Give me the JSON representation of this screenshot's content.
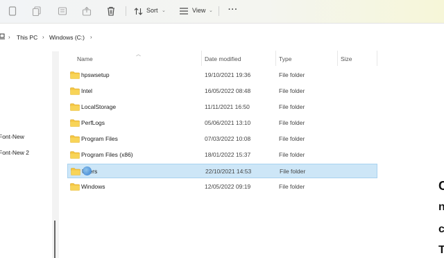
{
  "toolbar": {
    "sort_label": "Sort",
    "view_label": "View",
    "more_label": "···"
  },
  "address": {
    "crumbs": [
      "This PC",
      "Windows (C:)"
    ]
  },
  "sidebar": {
    "items": [
      "Font-New",
      "Font-New 2"
    ]
  },
  "columns": {
    "name": "Name",
    "date": "Date modified",
    "type": "Type",
    "size": "Size"
  },
  "files": [
    {
      "name": "hpswsetup",
      "date": "19/10/2021 19:36",
      "type": "File folder"
    },
    {
      "name": "Intel",
      "date": "16/05/2022 08:48",
      "type": "File folder"
    },
    {
      "name": "LocalStorage",
      "date": "11/11/2021 16:50",
      "type": "File folder"
    },
    {
      "name": "PerfLogs",
      "date": "05/06/2021 13:10",
      "type": "File folder"
    },
    {
      "name": "Program Files",
      "date": "07/03/2022 10:08",
      "type": "File folder"
    },
    {
      "name": "Program Files (x86)",
      "date": "18/01/2022 15:37",
      "type": "File folder"
    },
    {
      "name": "Users",
      "date": "22/10/2021 14:53",
      "type": "File folder",
      "selected": true
    },
    {
      "name": "Windows",
      "date": "12/05/2022 09:19",
      "type": "File folder"
    }
  ],
  "overlay_edge_glyphs": [
    "C",
    "n",
    "c",
    "T"
  ],
  "colors": {
    "selection": "#cde6f7",
    "folder": "#f4c542"
  }
}
